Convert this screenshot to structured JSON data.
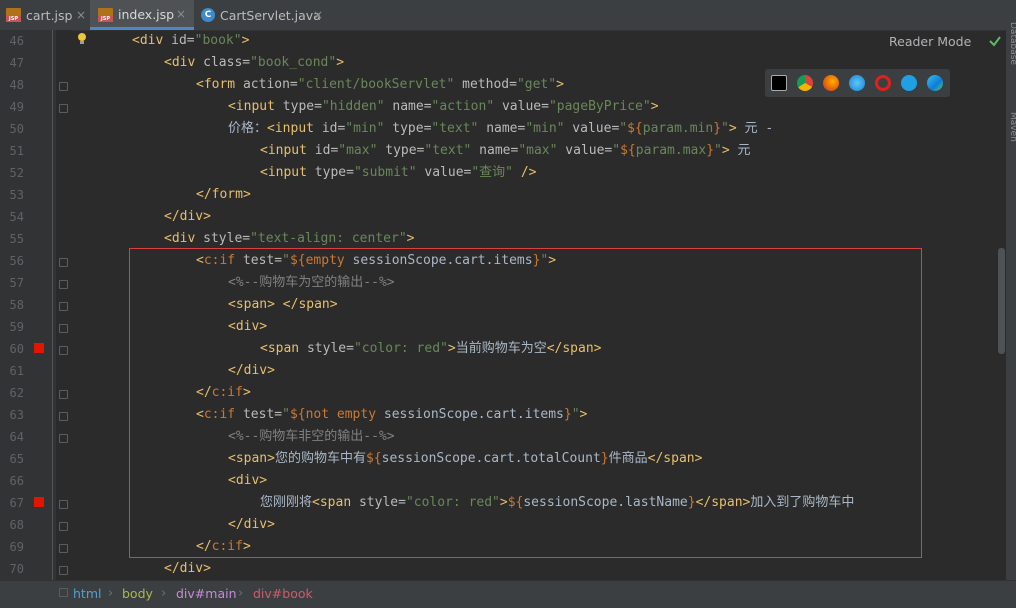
{
  "tabs": [
    {
      "label": "cart.jsp",
      "type": "jsp",
      "active": false
    },
    {
      "label": "index.jsp",
      "type": "jsp",
      "active": true
    },
    {
      "label": "CartServlet.java",
      "type": "java",
      "active": false
    }
  ],
  "tab_close_icon": "×",
  "jsp_badge": "JSP",
  "java_badge": "C",
  "reader_mode": "Reader Mode",
  "right_sidebar": [
    "Database",
    "Maven"
  ],
  "line_numbers": [
    "46",
    "47",
    "48",
    "49",
    "50",
    "51",
    "52",
    "53",
    "54",
    "55",
    "56",
    "57",
    "58",
    "59",
    "60",
    "61",
    "62",
    "63",
    "64",
    "65",
    "66",
    "67",
    "68",
    "69",
    "70"
  ],
  "breakpoint_lines": [
    "60",
    "67"
  ],
  "code_lines": [
    "<div id=\"book\">",
    "<div class=\"book_cond\">",
    "<form action=\"client/bookServlet\" method=\"get\">",
    "<input type=\"hidden\" name=\"action\" value=\"pageByPrice\">",
    "价格：<input id=\"min\" type=\"text\" name=\"min\" value=\"${param.min}\"> 元 -",
    "<input id=\"max\" type=\"text\" name=\"max\" value=\"${param.max}\"> 元",
    "<input type=\"submit\" value=\"查询\" />",
    "</form>",
    "</div>",
    "<div style=\"text-align: center\">",
    "<c:if test=\"${empty sessionScope.cart.items}\">",
    "<%--购物车为空的输出--%>",
    "<span> </span>",
    "<div>",
    "<span style=\"color: red\">当前购物车为空</span>",
    "</div>",
    "</c:if>",
    "<c:if test=\"${not empty sessionScope.cart.items}\">",
    "<%--购物车非空的输出--%>",
    "<span>您的购物车中有${sessionScope.cart.totalCount}件商品</span>",
    "<div>",
    "您刚刚将<span style=\"color: red\">${sessionScope.lastName}</span>加入到了购物车中",
    "</div>",
    "</c:if>",
    "</div>"
  ],
  "code_segments": {
    "l46": [
      "<div ",
      "id=",
      "\"book\"",
      ">"
    ],
    "l47": [
      "<div ",
      "class=",
      "\"book_cond\"",
      ">"
    ],
    "l48": [
      "<form ",
      "action=",
      "\"client/bookServlet\"",
      " method=",
      "\"get\"",
      ">"
    ],
    "l49": [
      "<input ",
      "type=",
      "\"hidden\"",
      " name=",
      "\"action\"",
      " value=",
      "\"pageByPrice\"",
      ">"
    ],
    "l50": [
      "价格：",
      "<input ",
      "id=",
      "\"min\"",
      " type=",
      "\"text\"",
      " name=",
      "\"min\"",
      " value=",
      "\"",
      "${",
      "param.min",
      "}",
      "\"",
      ">",
      " 元 -"
    ],
    "l51": [
      "<input ",
      "id=",
      "\"max\"",
      " type=",
      "\"text\"",
      " name=",
      "\"max\"",
      " value=",
      "\"",
      "${",
      "param.max",
      "}",
      "\"",
      ">",
      " 元"
    ],
    "l52": [
      "<input ",
      "type=",
      "\"submit\"",
      " value=",
      "\"查询\"",
      " />"
    ],
    "l53": [
      "</form>"
    ],
    "l54": [
      "</div>"
    ],
    "l55": [
      "<div ",
      "style=",
      "\"text-align: center\"",
      ">"
    ],
    "l56": [
      "<",
      "c:if",
      " test=",
      "\"",
      "${",
      "empty",
      " sessionScope.cart.items",
      "}",
      "\"",
      ">"
    ],
    "l57": [
      "<%--购物车为空的输出--%>"
    ],
    "l58": [
      "<span>",
      " ",
      "</span>"
    ],
    "l59": [
      "<div>"
    ],
    "l60": [
      "<span ",
      "style=",
      "\"color: red\"",
      ">",
      "当前购物车为空",
      "</span>"
    ],
    "l61": [
      "</div>"
    ],
    "l62": [
      "</",
      "c:if",
      ">"
    ],
    "l63": [
      "<",
      "c:if",
      " test=",
      "\"",
      "${",
      "not empty",
      " sessionScope.cart.items",
      "}",
      "\"",
      ">"
    ],
    "l64": [
      "<%--购物车非空的输出--%>"
    ],
    "l65": [
      "<span>",
      "您的购物车中有",
      "${",
      "sessionScope.cart.totalCount",
      "}",
      "件商品",
      "</span>"
    ],
    "l66": [
      "<div>"
    ],
    "l67": [
      "您刚刚将",
      "<span ",
      "style=",
      "\"color: red\"",
      ">",
      "${",
      "sessionScope.lastName",
      "}",
      "</span>",
      "加入到了购物车中"
    ],
    "l68": [
      "</div>"
    ],
    "l69": [
      "</",
      "c:if",
      ">"
    ],
    "l70": [
      "</div>"
    ]
  },
  "breadcrumb": [
    "html",
    "body",
    "div#main",
    "div#book"
  ],
  "breadcrumb_sep": "›",
  "browsers": [
    "intellij-icon",
    "chrome-icon",
    "firefox-icon",
    "safari-icon",
    "opera-icon",
    "ie-icon",
    "edge-icon"
  ],
  "colors": {
    "tag": "#e8bf6a",
    "string": "#6a8759",
    "keyword": "#cc7832",
    "comment": "#808080",
    "breakpoint": "#e51400",
    "highlight_box": "#d94040"
  }
}
